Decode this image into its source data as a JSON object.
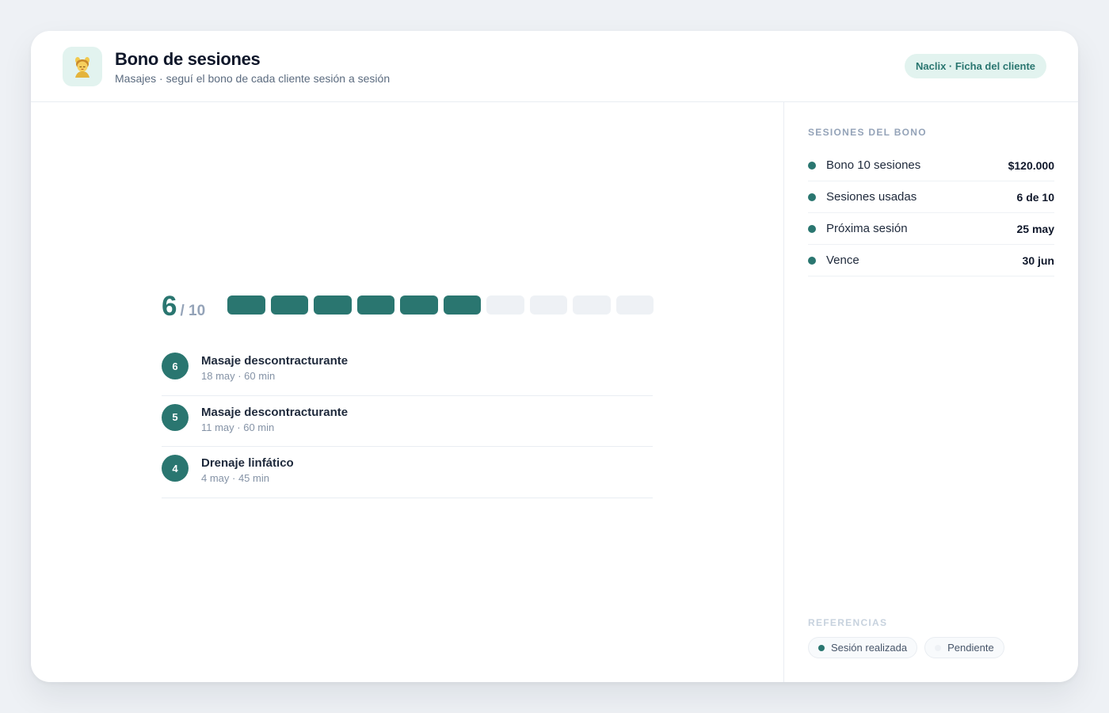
{
  "header": {
    "icon": "massage-person-icon",
    "title": "Bono de sesiones",
    "subtitle": "Masajes · seguí el bono de cada cliente sesión a sesión",
    "badge": "Naclix · Ficha del cliente"
  },
  "progress": {
    "used": "6",
    "total": "/ 10",
    "used_count": 6,
    "total_count": 10
  },
  "sessions": [
    {
      "number": "6",
      "name": "Masaje descontracturante",
      "meta": "18 may · 60 min"
    },
    {
      "number": "5",
      "name": "Masaje descontracturante",
      "meta": "11 may · 60 min"
    },
    {
      "number": "4",
      "name": "Drenaje linfático",
      "meta": "4 may · 45 min"
    }
  ],
  "sidebar": {
    "title": "SESIONES DEL BONO",
    "rows": [
      {
        "label": "Bono 10 sesiones",
        "value": "$120.000"
      },
      {
        "label": "Sesiones usadas",
        "value": "6 de 10"
      },
      {
        "label": "Próxima sesión",
        "value": "25 may"
      },
      {
        "label": "Vence",
        "value": "30 jun"
      }
    ],
    "references_title": "REFERENCIAS",
    "legend": [
      {
        "label": "Sesión realizada",
        "color": "#2a7670"
      },
      {
        "label": "Pendiente",
        "color": "#eef1f5"
      }
    ]
  },
  "colors": {
    "accent": "#2a7670",
    "accent_soft": "#e2f3ef",
    "pending": "#eef1f5"
  }
}
